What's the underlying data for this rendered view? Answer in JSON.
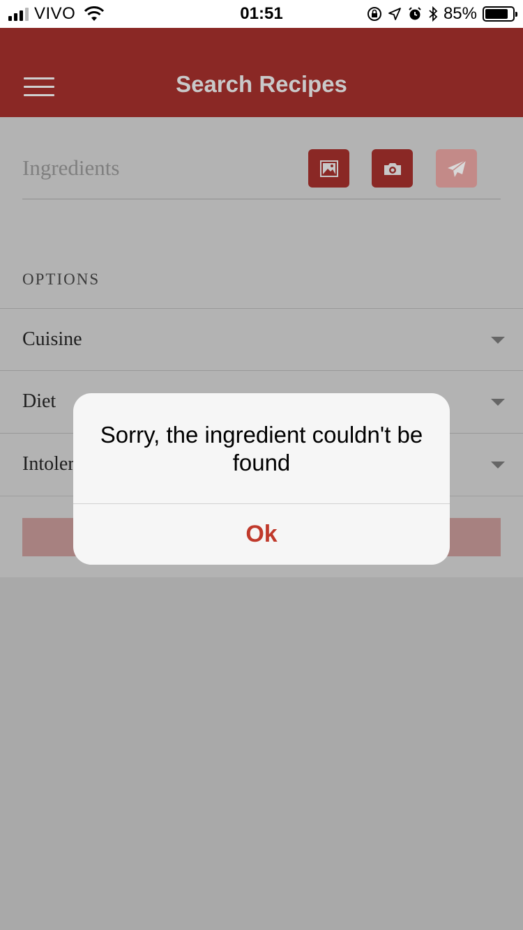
{
  "status_bar": {
    "carrier": "VIVO",
    "time": "01:51",
    "battery": "85%",
    "battery_level": 0.85,
    "signal_bars": 3
  },
  "header": {
    "title": "Search Recipes",
    "menu_icon": "hamburger-menu-icon"
  },
  "search": {
    "placeholder": "Ingredients",
    "buttons": [
      {
        "icon": "image-icon",
        "enabled": true
      },
      {
        "icon": "camera-icon",
        "enabled": true
      },
      {
        "icon": "send-icon",
        "enabled": false
      }
    ]
  },
  "options": {
    "heading": "OPTIONS",
    "rows": [
      {
        "label": "Cuisine"
      },
      {
        "label": "Diet"
      },
      {
        "label": "Intoler"
      }
    ]
  },
  "alert": {
    "message": "Sorry, the ingredient couldn't be found",
    "button": "Ok"
  },
  "colors": {
    "brand": "#8a2825",
    "accent_text": "#c0392b",
    "overlay": "#a9a9a9"
  }
}
